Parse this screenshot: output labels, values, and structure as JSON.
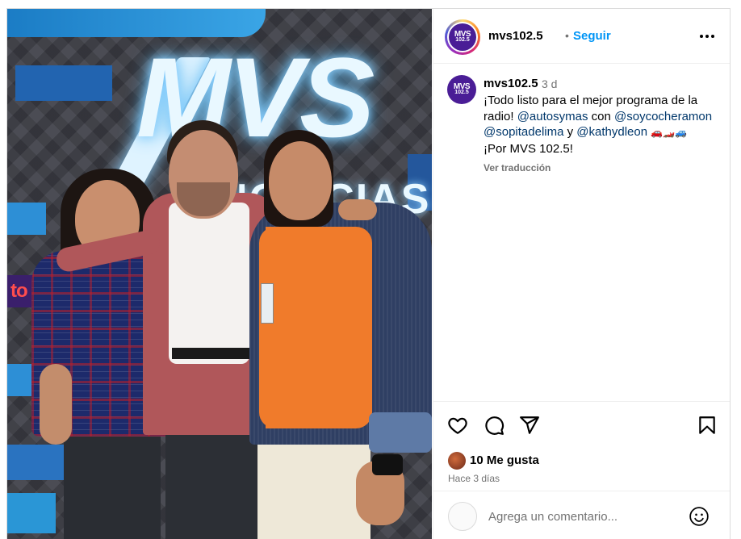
{
  "post": {
    "username": "mvs102.5",
    "separator": "•",
    "follow_label": "Seguir",
    "avatar_logo": {
      "line1": "MVS",
      "line2": "102.5",
      "color": "#4a1d96"
    }
  },
  "photo": {
    "studio_logo": "MVS",
    "studio_logo_sub": "NOTICIAS",
    "led_sign": "to"
  },
  "caption": {
    "username": "mvs102.5",
    "time": "3 d",
    "text_1": "¡Todo listo para el mejor programa de la radio! ",
    "mention_1": "@autosymas",
    "text_2": " con ",
    "mention_2": "@soycocheramon",
    "mention_3": "@sopitadelima",
    "text_3": " y ",
    "mention_4": "@kathydleon",
    "vehicles": "🚗🏎️🚙",
    "text_4": "¡Por MVS 102.5!",
    "translate_label": "Ver traducción"
  },
  "actions": {
    "icons": [
      "heart-icon",
      "comment-icon",
      "share-icon",
      "bookmark-icon"
    ],
    "likes_label": "10 Me gusta",
    "time_ago": "Hace 3 días"
  },
  "comment_box": {
    "placeholder": "Agrega un comentario...",
    "emoji_icon": "smiley-icon"
  },
  "colors": {
    "link_blue": "#0095f6",
    "mention_blue": "#00376b",
    "muted": "#737373",
    "border": "#dbdbdb"
  }
}
